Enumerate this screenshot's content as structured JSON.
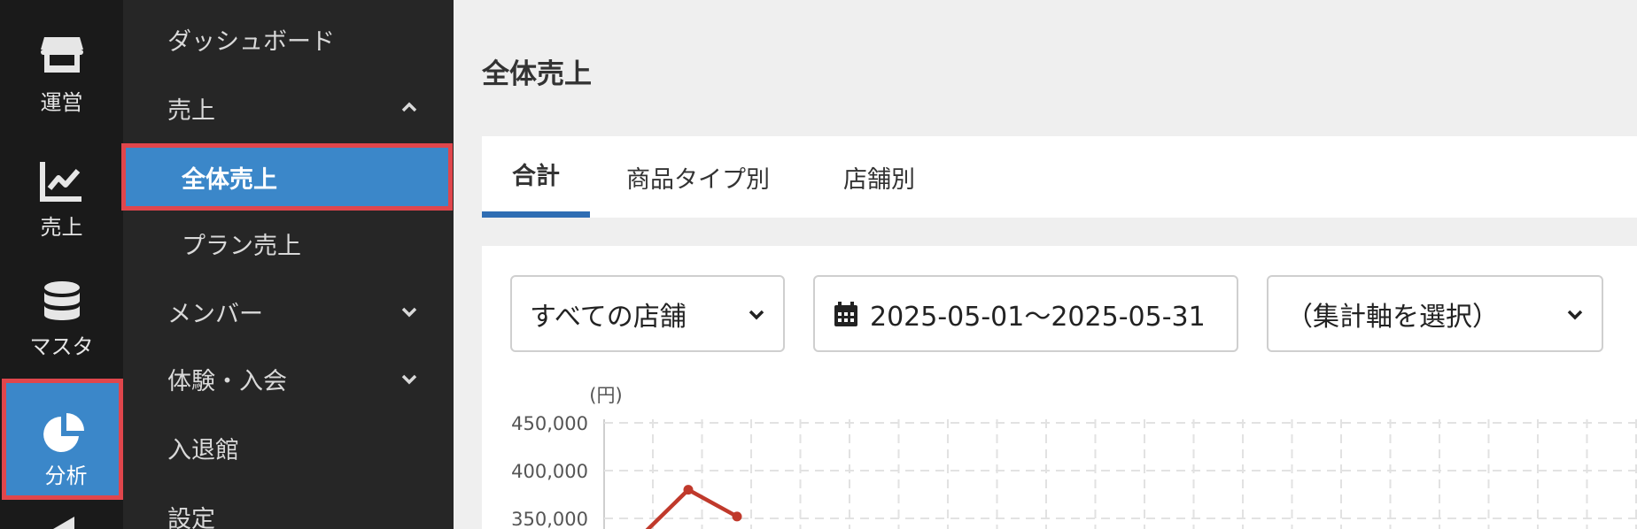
{
  "rail": {
    "items": [
      {
        "label": "運営",
        "icon": "store-icon"
      },
      {
        "label": "売上",
        "icon": "chart-line-icon"
      },
      {
        "label": "マスタ",
        "icon": "database-icon"
      },
      {
        "label": "分析",
        "icon": "pie-chart-icon",
        "active": true
      }
    ]
  },
  "nav": {
    "items": [
      {
        "label": "ダッシュボード"
      },
      {
        "label": "売上",
        "expanded": true
      },
      {
        "label": "全体売上",
        "selected": true
      },
      {
        "label": "プラン売上"
      },
      {
        "label": "メンバー"
      },
      {
        "label": "体験・入会"
      },
      {
        "label": "入退館"
      },
      {
        "label": "設定"
      }
    ]
  },
  "main": {
    "title": "全体売上",
    "tabs": [
      {
        "label": "合計",
        "active": true
      },
      {
        "label": "商品タイプ別"
      },
      {
        "label": "店舗別"
      }
    ],
    "filters": {
      "store": "すべての店舗",
      "date_range": "2025-05-01〜2025-05-31",
      "axis": "（集計軸を選択）"
    }
  },
  "chart_data": {
    "type": "line",
    "ylabel": "(円)",
    "y_ticks": [
      "450,000",
      "400,000",
      "350,000"
    ],
    "ylim": [
      350000,
      450000
    ],
    "series": [
      {
        "values": [
          330000,
          380000,
          352000
        ]
      }
    ],
    "grid": true,
    "line_color": "#c0392b"
  },
  "colors": {
    "accent": "#3b87c9",
    "highlight_border": "#e0464c",
    "tab_underline": "#2f6db3"
  }
}
